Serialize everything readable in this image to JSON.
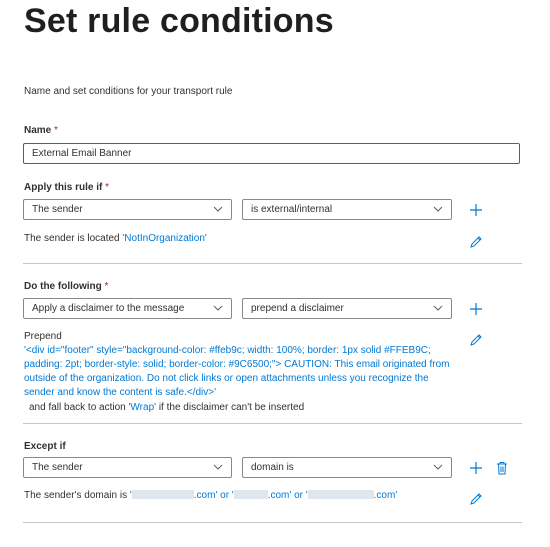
{
  "page": {
    "title": "Set rule conditions",
    "description": "Name and set conditions for your transport rule"
  },
  "name": {
    "label": "Name",
    "required_mark": "*",
    "value": "External Email Banner"
  },
  "apply_if": {
    "label": "Apply this rule if",
    "required_mark": "*",
    "condition": "The sender",
    "operator": "is external/internal",
    "summary_prefix": "The sender is located ",
    "summary_value": "'NotInOrganization'"
  },
  "do_following": {
    "label": "Do the following",
    "required_mark": "*",
    "action": "Apply a disclaimer to the message",
    "sub_action": "prepend a disclaimer",
    "prepend_label": "Prepend",
    "disclaimer_lines": [
      "'<div id=\"footer\" style=\"background-color: #ffeb9c; width: 100%; border: 1px solid #FFEB9C;",
      "padding: 2pt; border-style: solid; border-color: #9C6500;\"> CAUTION: This email originated from",
      "outside of the organization. Do not click links or open attachments unless you recognize the",
      "sender and know the content is safe.</div>'"
    ],
    "fallback_prefix": "and fall back to action ",
    "fallback_value": "'Wrap'",
    "fallback_suffix": " if the disclaimer can't be inserted"
  },
  "except_if": {
    "label": "Except if",
    "condition": "The sender",
    "operator": "domain is",
    "summary_prefix": "The sender's domain is ",
    "domain_q1": "'",
    "domain_s1": ".com' or '",
    "domain_s2": ".com' or '",
    "domain_s3": ".com'"
  },
  "icons": [
    "add-icon",
    "edit-icon",
    "delete-icon",
    "chevron-down-icon"
  ],
  "colors": {
    "accent": "#0078d4",
    "required": "#a4262c",
    "divider": "#c8c6c4"
  }
}
